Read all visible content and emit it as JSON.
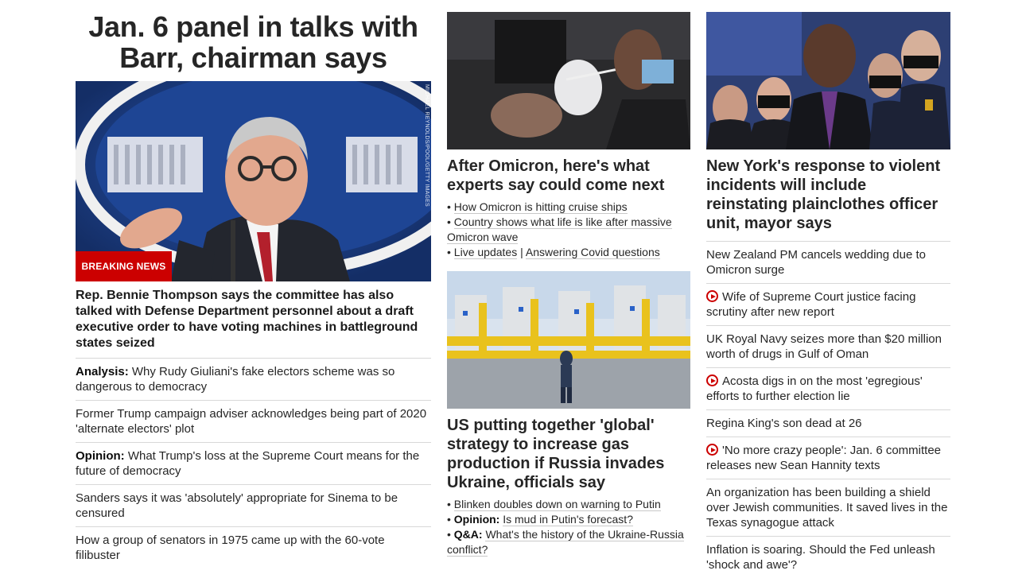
{
  "left": {
    "headline": "Jan. 6 panel in talks with Barr, chairman says",
    "image_credit": "MICHAEL REYNOLDS/POOL/GETTY IMAGES",
    "badge": "BREAKING NEWS",
    "caption": "Rep. Bennie Thompson says the committee has also talked with Defense Department personnel about a draft executive order to have voting machines in battleground states seized",
    "items": [
      {
        "label": "Analysis:",
        "text": "Why Rudy Giuliani's fake electors scheme was so dangerous to democracy"
      },
      {
        "label": "",
        "text": "Former Trump campaign adviser acknowledges being part of 2020 'alternate electors' plot"
      },
      {
        "label": "Opinion:",
        "text": "What Trump's loss at the Supreme Court means for the future of democracy"
      },
      {
        "label": "",
        "text": "Sanders says it was 'absolutely' appropriate for Sinema to be censured"
      },
      {
        "label": "",
        "text": "How a group of senators in 1975 came up with the 60-vote filibuster"
      }
    ]
  },
  "mid": {
    "story1": {
      "headline": "After Omicron, here's what experts say could come next",
      "bullet1": "How Omicron is hitting cruise ships",
      "bullet2": "Country shows what life is like after massive Omicron wave",
      "bullet3a": "Live updates",
      "separator": "|",
      "bullet3b": "Answering Covid questions"
    },
    "story2": {
      "headline": "US putting together 'global' strategy to increase gas production if Russia invades Ukraine, officials say",
      "bullet1": "Blinken doubles down on warning to Putin",
      "bullet2_label": "Opinion:",
      "bullet2": "Is mud in Putin's forecast?",
      "bullet3_label": "Q&A:",
      "bullet3": "What's the history of the Ukraine-Russia conflict?"
    }
  },
  "right": {
    "headline": "New York's response to violent incidents will include reinstating plainclothes officer unit, mayor says",
    "items": [
      {
        "video": false,
        "text": "New Zealand PM cancels wedding due to Omicron surge"
      },
      {
        "video": true,
        "text": "Wife of Supreme Court justice facing scrutiny after new report"
      },
      {
        "video": false,
        "text": "UK Royal Navy seizes more than $20 million worth of drugs in Gulf of Oman"
      },
      {
        "video": true,
        "text": "Acosta digs in on the most 'egregious' efforts to further election lie"
      },
      {
        "video": false,
        "text": "Regina King's son dead at 26"
      },
      {
        "video": true,
        "text": "'No more crazy people': Jan. 6 committee releases new Sean Hannity texts"
      },
      {
        "video": false,
        "text": "An organization has been building a shield over Jewish communities. It saved lives in the Texas synagogue attack"
      },
      {
        "video": false,
        "text": "Inflation is soaring. Should the Fed unleash 'shock and awe'?"
      }
    ]
  },
  "colors": {
    "accent": "#cc0000",
    "divider": "#d8d8d8",
    "text": "#262626"
  }
}
